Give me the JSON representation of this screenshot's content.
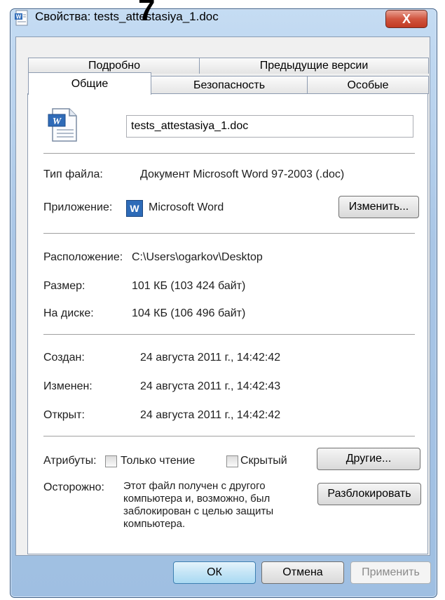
{
  "window": {
    "title": "Свойства: tests_attestasiya_1.doc",
    "overlay_number": "7",
    "close_glyph": "X"
  },
  "tabs": {
    "row_top": [
      "Подробно",
      "Предыдущие версии"
    ],
    "row_bottom": [
      "Общие",
      "Безопасность",
      "Особые"
    ],
    "active": "Общие"
  },
  "general": {
    "filename": "tests_attestasiya_1.doc",
    "type_label": "Тип файла:",
    "type_value": "Документ Microsoft Word 97-2003 (.doc)",
    "app_label": "Приложение:",
    "app_value": "Microsoft Word",
    "app_icon_glyph": "W",
    "change_button": "Изменить...",
    "location_label": "Расположение:",
    "location_value": "C:\\Users\\ogarkov\\Desktop",
    "size_label": "Размер:",
    "size_value": "101 КБ (103 424 байт)",
    "disk_label": "На диске:",
    "disk_value": "104 КБ (106 496 байт)",
    "created_label": "Создан:",
    "created_value": "24 августа 2011 г., 14:42:42",
    "modified_label": "Изменен:",
    "modified_value": "24 августа 2011 г., 14:42:43",
    "opened_label": "Открыт:",
    "opened_value": "24 августа 2011 г., 14:42:42",
    "attributes_label": "Атрибуты:",
    "readonly_label": "Только чтение",
    "readonly_checked": false,
    "hidden_label": "Скрытый",
    "hidden_checked": false,
    "other_button": "Другие...",
    "warning_label": "Осторожно:",
    "warning_text": "Этот файл получен с другого компьютера и, возможно, был заблокирован с целью защиты компьютера.",
    "unblock_button": "Разблокировать"
  },
  "footer": {
    "ok": "ОК",
    "cancel": "Отмена",
    "apply": "Применить"
  },
  "colors": {
    "frame": "#a9c6e6",
    "close_button": "#c13a22",
    "default_button": "#a9d9f2"
  }
}
